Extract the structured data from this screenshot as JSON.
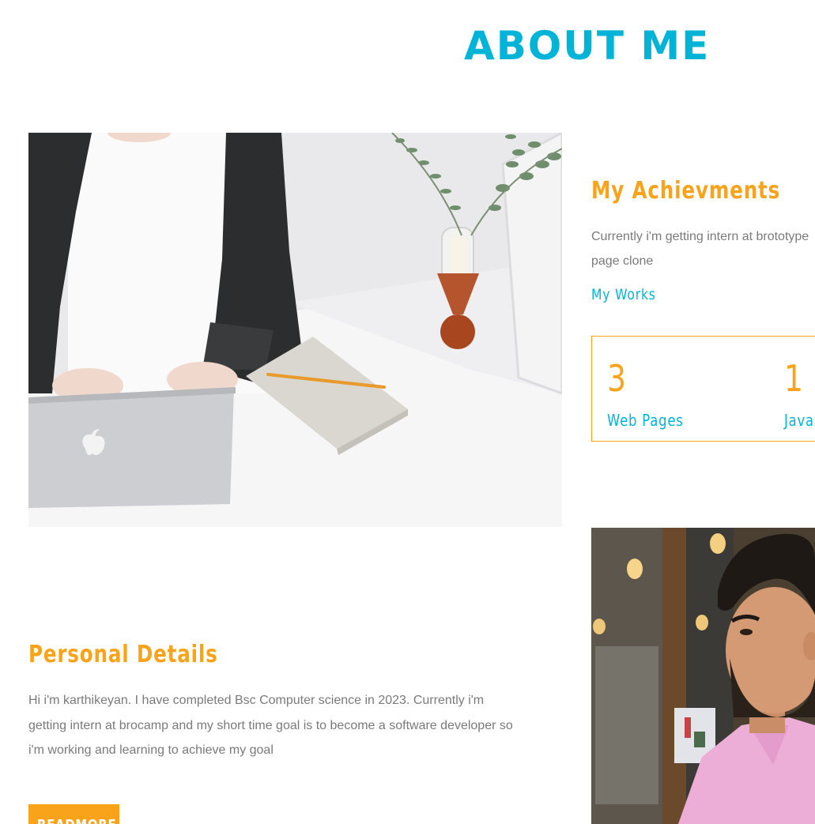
{
  "page": {
    "title": "ABOUT ME"
  },
  "achievements": {
    "title": "My Achievments",
    "text_lines": [
      "Currently i'm getting intern at brototype",
      "page clone"
    ],
    "works_link": "My Works",
    "stats": [
      {
        "number": "3",
        "label": "Web Pages"
      },
      {
        "number": "1",
        "label": "Java"
      }
    ]
  },
  "personal": {
    "title": "Personal Details",
    "text_lines": [
      "Hi i'm karthikeyan. I have completed Bsc Computer science in 2023. Currently i'm",
      "getting intern at brocamp and my short time goal is to become a software developer so",
      "i'm working and learning to achieve my goal"
    ],
    "button_label": "READMORE"
  },
  "colors": {
    "accent": "#00b4d8",
    "brand": "#f9a31b",
    "body_text": "#7a7a7a"
  },
  "images": {
    "desk_photo": "woman-laptop-desk-photo",
    "portrait_photo": "man-portrait-photo"
  }
}
